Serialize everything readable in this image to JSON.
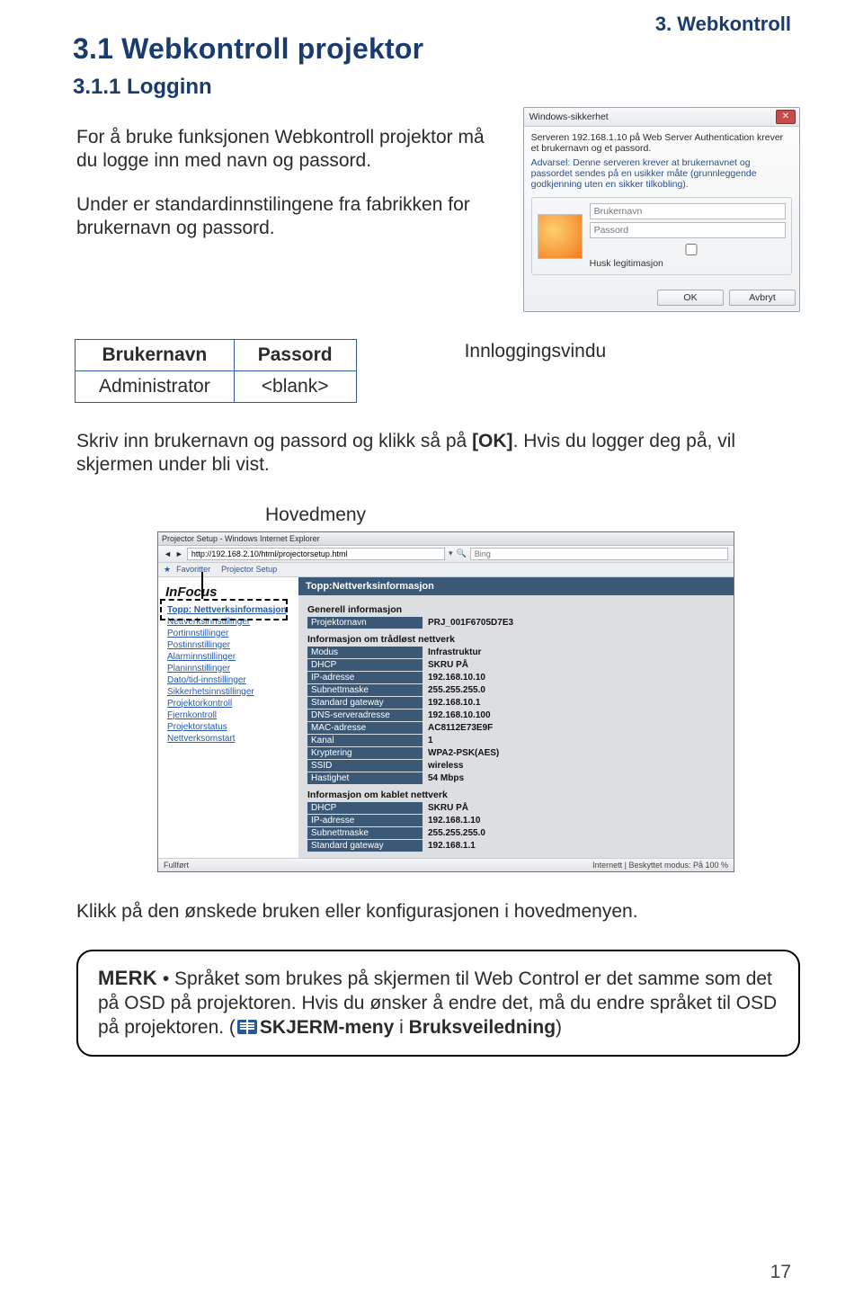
{
  "crumb": "3. Webkontroll",
  "h1": "3.1 Webkontroll projektor",
  "h2": "3.1.1 Logginn",
  "intro": "For å bruke funksjonen Webkontroll projektor må du logge inn med navn og passord.",
  "intro2": "Under er standardinnstilingene fra fabrikken for brukernavn og passord.",
  "dialog": {
    "title": "Windows-sikkerhet",
    "line1": "Serveren 192.168.1.10 på Web Server Authentication krever et brukernavn og et passord.",
    "warn": "Advarsel: Denne serveren krever at brukernavnet og passordet sendes på en usikker måte (grunnleggende godkjenning uten en sikker tilkobling).",
    "user_ph": "Brukernavn",
    "pass_ph": "Passord",
    "remember": "Husk legitimasjon",
    "ok": "OK",
    "cancel": "Avbryt"
  },
  "creds": {
    "h_user": "Brukernavn",
    "h_pass": "Passord",
    "user": "Administrator",
    "pass": "<blank>"
  },
  "login_label": "Innloggingsvindu",
  "para2a": "Skriv inn brukernavn og passord og klikk så på ",
  "para2b": "[OK]",
  "para2c": ". Hvis du logger deg på, vil skjermen under bli vist.",
  "mainmenu_label": "Hovedmeny",
  "browser": {
    "title": "Projector Setup - Windows Internet Explorer",
    "url": "http://192.168.2.10/html/projectorsetup.html",
    "search": "Bing",
    "fav_star": "Favoritter",
    "fav_pg": "Projector Setup",
    "sidebar_brand": "InFocus",
    "sidebar": [
      "Topp: Nettverksinformasjon",
      "Nettverksinnstillinger",
      "Portinnstillinger",
      "Postinnstillinger",
      "Alarminnstillinger",
      "Planinnstillinger",
      "Dato/tid-innstillinger",
      "Sikkerhetsinnstillinger",
      "Projektorkontroll",
      "Fjernkontroll",
      "Projektorstatus",
      "Nettverksomstart"
    ],
    "panel_head": "Topp:Nettverksinformasjon",
    "sect1": "Generell informasjon",
    "kv1": [
      [
        "Projektornavn",
        "PRJ_001F6705D7E3"
      ]
    ],
    "sect2": "Informasjon om trådløst nettverk",
    "kv2": [
      [
        "Modus",
        "Infrastruktur"
      ],
      [
        "DHCP",
        "SKRU PÅ"
      ],
      [
        "IP-adresse",
        "192.168.10.10"
      ],
      [
        "Subnettmaske",
        "255.255.255.0"
      ],
      [
        "Standard gateway",
        "192.168.10.1"
      ],
      [
        "DNS-serveradresse",
        "192.168.10.100"
      ],
      [
        "MAC-adresse",
        "AC8112E73E9F"
      ],
      [
        "Kanal",
        "1"
      ],
      [
        "Kryptering",
        "WPA2-PSK(AES)"
      ],
      [
        "SSID",
        "wireless"
      ],
      [
        "Hastighet",
        "54 Mbps"
      ]
    ],
    "sect3": "Informasjon om kablet nettverk",
    "kv3": [
      [
        "DHCP",
        "SKRU PÅ"
      ],
      [
        "IP-adresse",
        "192.168.1.10"
      ],
      [
        "Subnettmaske",
        "255.255.255.0"
      ],
      [
        "Standard gateway",
        "192.168.1.1"
      ]
    ],
    "status_left": "Fullført",
    "status_right": "Internett | Beskyttet modus: På     100 %"
  },
  "after_browser": "Klikk på den ønskede bruken eller konfigurasjonen i hovedmenyen.",
  "merk": {
    "label": "MERK",
    "bullet": " • ",
    "text1": "Språket som brukes på skjermen til Web Control er det samme som det på OSD på projektoren. Hvis du ønsker å endre det, må du endre språket til OSD på projektoren. (",
    "ref": "SKJERM-meny",
    "text2": " i ",
    "ref2": "Bruksveiledning",
    "text3": ")"
  },
  "pageno": "17"
}
